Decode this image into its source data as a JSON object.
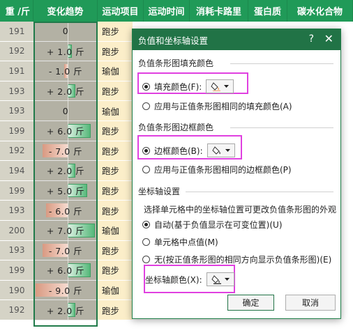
{
  "headers": [
    "重 /斤",
    "变化趋势",
    "运动项目",
    "运动时间",
    "消耗卡路里",
    "蛋白质",
    "碳水化合物"
  ],
  "rows": [
    {
      "weight": "191",
      "trend": "0",
      "change": 0,
      "activity": "跑步"
    },
    {
      "weight": "192",
      "trend": "+ 1.0 斤",
      "change": 1.0,
      "activity": "跑步"
    },
    {
      "weight": "191",
      "trend": "- 1.0 斤",
      "change": -1.0,
      "activity": "瑜伽"
    },
    {
      "weight": "193",
      "trend": "+ 2.0 斤",
      "change": 2.0,
      "activity": "跑步"
    },
    {
      "weight": "193",
      "trend": "0",
      "change": 0,
      "activity": "瑜伽"
    },
    {
      "weight": "199",
      "trend": "+ 6.0 斤",
      "change": 6.0,
      "activity": "跑步"
    },
    {
      "weight": "192",
      "trend": "- 7.0 斤",
      "change": -7.0,
      "activity": "跑步"
    },
    {
      "weight": "194",
      "trend": "+ 2.0 斤",
      "change": 2.0,
      "activity": "跑步"
    },
    {
      "weight": "199",
      "trend": "+ 5.0 斤",
      "change": 5.0,
      "activity": "跑步"
    },
    {
      "weight": "193",
      "trend": "- 6.0 斤",
      "change": -6.0,
      "activity": "跑步"
    },
    {
      "weight": "200",
      "trend": "+ 7.0 斤",
      "change": 7.0,
      "activity": "瑜伽"
    },
    {
      "weight": "193",
      "trend": "- 7.0 斤",
      "change": -7.0,
      "activity": "跑步"
    },
    {
      "weight": "199",
      "trend": "+ 6.0 斤",
      "change": 6.0,
      "activity": "跑步"
    },
    {
      "weight": "190",
      "trend": "- 9.0 斤",
      "change": -9.0,
      "activity": "瑜伽"
    },
    {
      "weight": "192",
      "trend": "+ 2.0 斤",
      "change": 2.0,
      "activity": "跑步"
    }
  ],
  "dialog": {
    "title": "负值和坐标轴设置",
    "help": "?",
    "close": "✕",
    "fill_section": "负值条形图填充颜色",
    "fill_color_label": "填充颜色(F):",
    "fill_same_label": "应用与正值条形图相同的填充颜色(A)",
    "border_section": "负值条形图边框颜色",
    "border_color_label": "边框颜色(B):",
    "border_same_label": "应用与正值条形图相同的边框颜色(P)",
    "axis_section": "坐标轴设置",
    "axis_desc": "选择单元格中的坐标轴位置可更改负值条形图的外观",
    "axis_auto": "自动(基于负值显示在可变位置)(U)",
    "axis_mid": "单元格中点值(M)",
    "axis_none": "无(按正值条形图的相同方向显示负值条形图)(E)",
    "axis_color_label": "坐标轴颜色(X):",
    "ok": "确定",
    "cancel": "取消"
  },
  "colors": {
    "positive_bar": "#56b87a",
    "negative_bar": "#d99a82",
    "highlight": "#e040e0",
    "title_bar": "#217346"
  },
  "icons": {
    "color_picker": "paint-bucket-icon",
    "dropdown": "dropdown-arrow-icon"
  }
}
